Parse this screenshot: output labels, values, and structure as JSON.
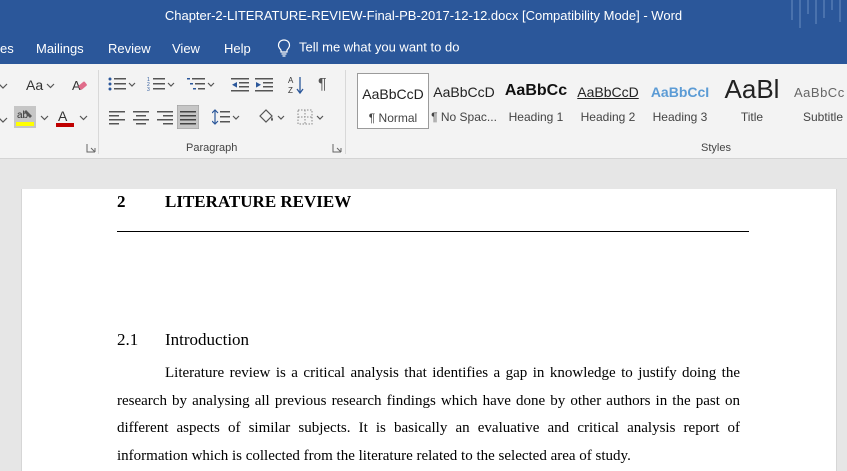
{
  "window": {
    "title": "Chapter-2-LITERATURE-REVIEW-Final-PB-2017-12-12.docx [Compatibility Mode]  -  Word"
  },
  "menu": {
    "items": [
      "es",
      "Mailings",
      "Review",
      "View",
      "Help"
    ],
    "tell_me": "Tell me what you want to do"
  },
  "ribbon": {
    "font_group": {
      "change_case_label": "Aa",
      "highlight_color": "#ffff00",
      "font_color": "#c00000"
    },
    "paragraph_group": {
      "label": "Paragraph"
    },
    "styles_group": {
      "label": "Styles",
      "items": [
        {
          "sample": "AaBbCcD",
          "name": "¶ Normal"
        },
        {
          "sample": "AaBbCcD",
          "name": "¶ No Spac..."
        },
        {
          "sample": "AaBbCc",
          "name": "Heading 1"
        },
        {
          "sample": "AaBbCcD",
          "name": "Heading 2"
        },
        {
          "sample": "AaBbCcI",
          "name": "Heading 3"
        },
        {
          "sample": "AaBl",
          "name": "Title"
        },
        {
          "sample": "AaBbCc",
          "name": "Subtitle"
        }
      ]
    }
  },
  "document": {
    "heading1": {
      "number": "2",
      "text": "LITERATURE REVIEW"
    },
    "heading2": {
      "number": "2.1",
      "text": "Introduction"
    },
    "paragraph": "Literature review is a critical analysis that identifies a gap in knowledge to justify doing the research by analysing all previous research findings which have done by other authors in the past on different aspects of similar subjects. It is basically an evaluative and critical analysis report of information which is collected from the literature related to the selected area of study."
  },
  "colors": {
    "title_bar": "#2b579a",
    "ribbon_bg": "#f3f3f3",
    "canvas_bg": "#e6e6e6",
    "heading3_blue": "#5b9bd5"
  }
}
